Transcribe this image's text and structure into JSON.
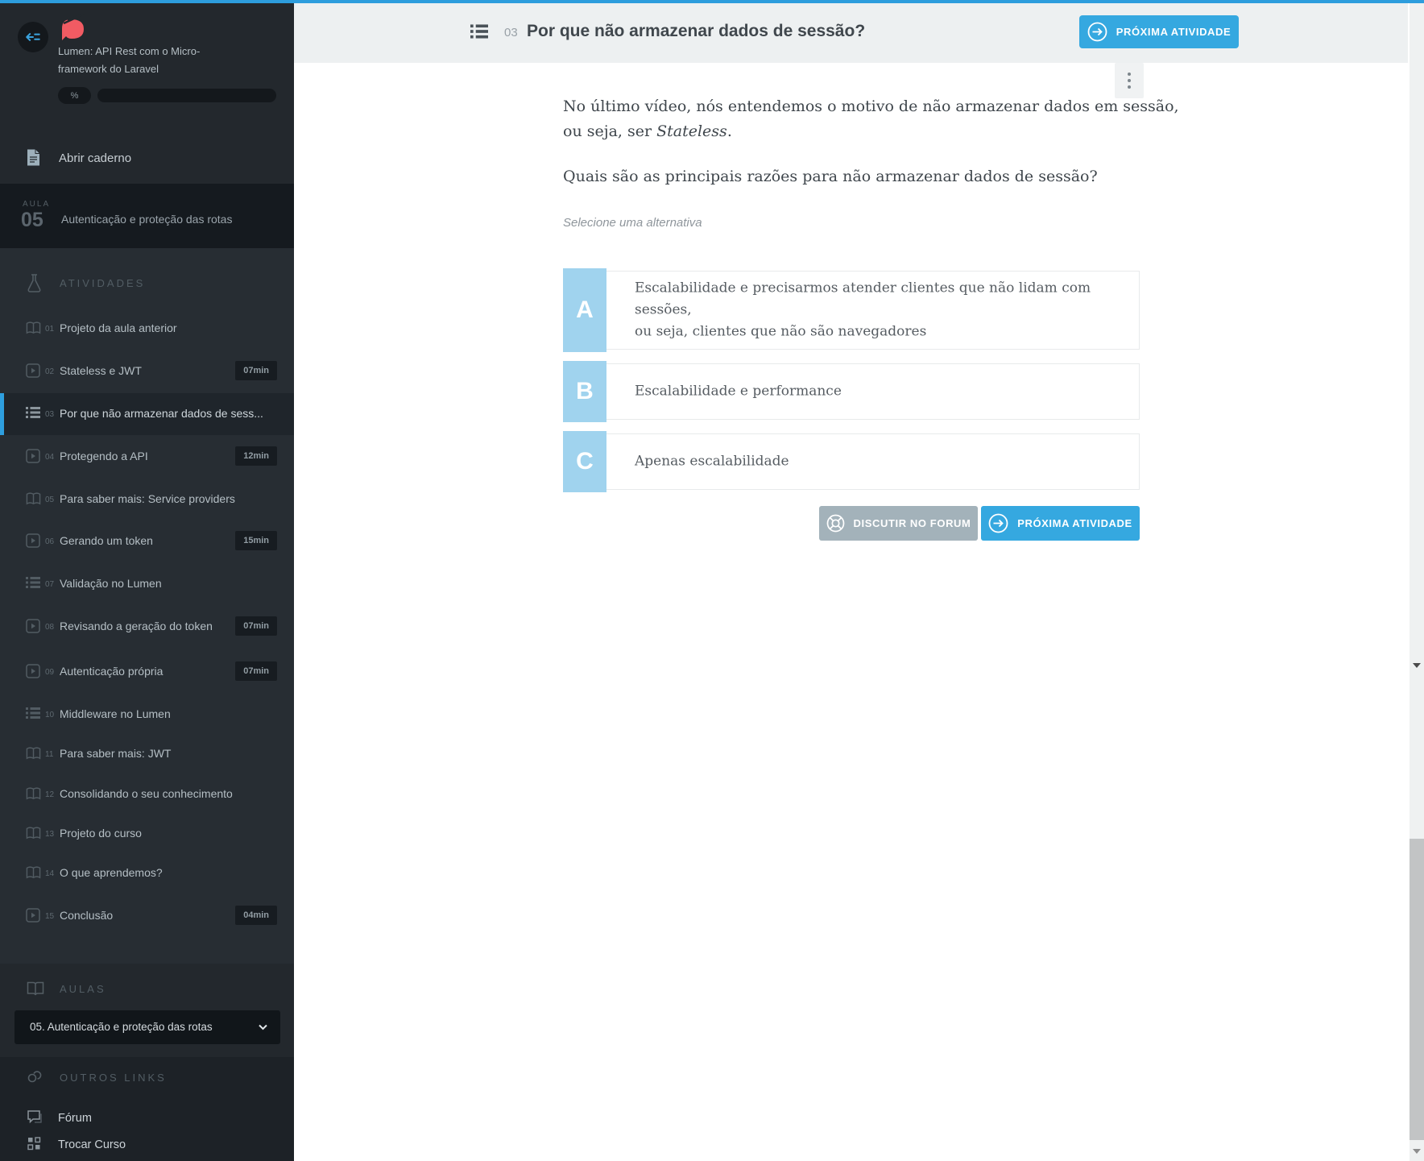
{
  "colors": {
    "topbar_blue": "#2d9ddd",
    "accent_blue": "#35a8e0",
    "option_letter_blue": "#a0d3ee",
    "gray_button": "#a3b2ba"
  },
  "sidebar": {
    "course_title_line1": "Lumen: API Rest com o Micro-",
    "course_title_line2": "framework do Laravel",
    "progress_badge": "%",
    "notebook_label": "Abrir caderno",
    "lesson_banner": {
      "label": "AULA",
      "number": "05",
      "title": "Autenticação e proteção das rotas"
    },
    "activities_header": "ATIVIDADES",
    "activities": [
      {
        "num": "01",
        "title": "Projeto da aula anterior"
      },
      {
        "num": "02",
        "title": "Stateless e JWT",
        "duration": "07min"
      },
      {
        "num": "03",
        "title": "Por que não armazenar dados de sess..."
      },
      {
        "num": "04",
        "title": "Protegendo a API",
        "duration": "12min"
      },
      {
        "num": "05",
        "title": "Para saber mais: Service providers"
      },
      {
        "num": "06",
        "title": "Gerando um token",
        "duration": "15min"
      },
      {
        "num": "07",
        "title": "Validação no Lumen"
      },
      {
        "num": "08",
        "title": "Revisando a geração do token",
        "duration": "07min"
      },
      {
        "num": "09",
        "title": "Autenticação própria",
        "duration": "07min"
      },
      {
        "num": "10",
        "title": "Middleware no Lumen"
      },
      {
        "num": "11",
        "title": "Para saber mais: JWT"
      },
      {
        "num": "12",
        "title": "Consolidando o seu conhecimento"
      },
      {
        "num": "13",
        "title": "Projeto do curso"
      },
      {
        "num": "14",
        "title": "O que aprendemos?"
      },
      {
        "num": "15",
        "title": "Conclusão",
        "duration": "04min"
      }
    ],
    "aulas_header": "AULAS",
    "lesson_select": "05. Autenticação e proteção das rotas",
    "other_links_header": "OUTROS LINKS",
    "forum_label": "Fórum",
    "switch_course_label": "Trocar Curso"
  },
  "main": {
    "header": {
      "number": "03",
      "title": "Por que não armazenar dados de sessão?",
      "next_button": "PRÓXIMA ATIVIDADE"
    },
    "question": {
      "p1_line1": "No último vídeo, nós entendemos o motivo de não armazenar dados em sessão,",
      "p1_line2_pre": "ou seja, ser ",
      "p1_line2_em": "Stateless",
      "p1_line2_end": ".",
      "p2": "Quais são as principais razões para não armazenar dados de sessão?",
      "hint": "Selecione uma alternativa"
    },
    "options": [
      {
        "letter": "A",
        "line1": "Escalabilidade e precisarmos atender clientes que não lidam com sessões,",
        "line2": "ou seja, clientes que não são navegadores"
      },
      {
        "letter": "B",
        "line1": "Escalabilidade e performance",
        "line2": ""
      },
      {
        "letter": "C",
        "line1": "Apenas escalabilidade",
        "line2": ""
      }
    ],
    "footer": {
      "discuss_button": "DISCUTIR NO FORUM",
      "next_button": "PRÓXIMA ATIVIDADE"
    }
  }
}
